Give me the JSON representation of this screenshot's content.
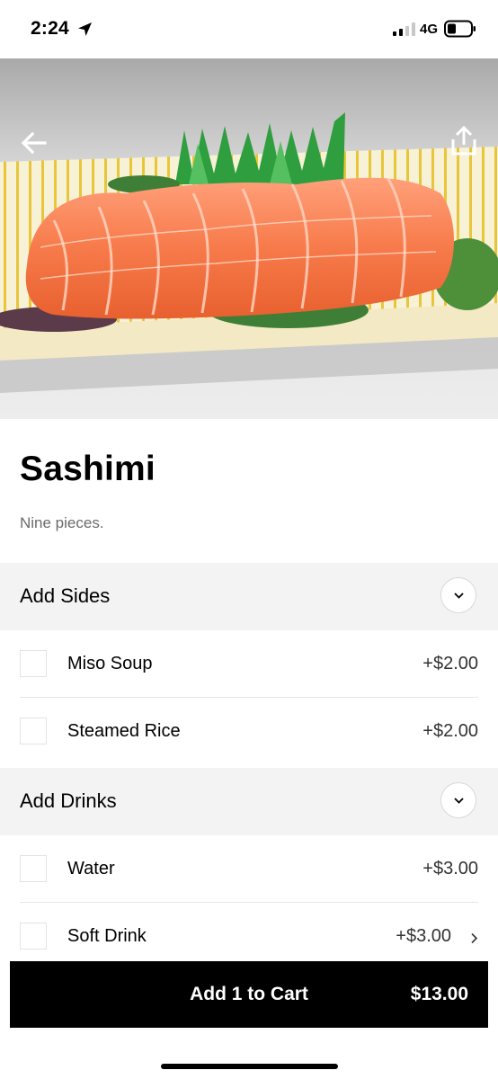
{
  "status_bar": {
    "time": "2:24",
    "network": "4G",
    "icons": [
      "location-arrow-icon",
      "signal-icon",
      "battery-icon"
    ]
  },
  "hero": {
    "image": "salmon-sashimi-photo",
    "icons": [
      "back-arrow-icon",
      "share-icon"
    ]
  },
  "item": {
    "title": "Sashimi",
    "description": "Nine pieces."
  },
  "groups": [
    {
      "title": "Add Sides",
      "icon": "chevron-down-icon",
      "options": [
        {
          "label": "Miso Soup",
          "price": "+$2.00"
        },
        {
          "label": "Steamed Rice",
          "price": "+$2.00"
        }
      ]
    },
    {
      "title": "Add Drinks",
      "icon": "chevron-down-icon",
      "options": [
        {
          "label": "Water",
          "price": "+$3.00"
        },
        {
          "label": "Soft Drink",
          "price": "+$3.00",
          "icon": "chevron-right-icon"
        }
      ]
    }
  ],
  "cart": {
    "label": "Add 1 to Cart",
    "total": "$13.00"
  },
  "colors": {
    "group_header_bg": "#f3f3f3",
    "cart_bg": "#000000",
    "secondary_text": "#6b6b6b"
  }
}
